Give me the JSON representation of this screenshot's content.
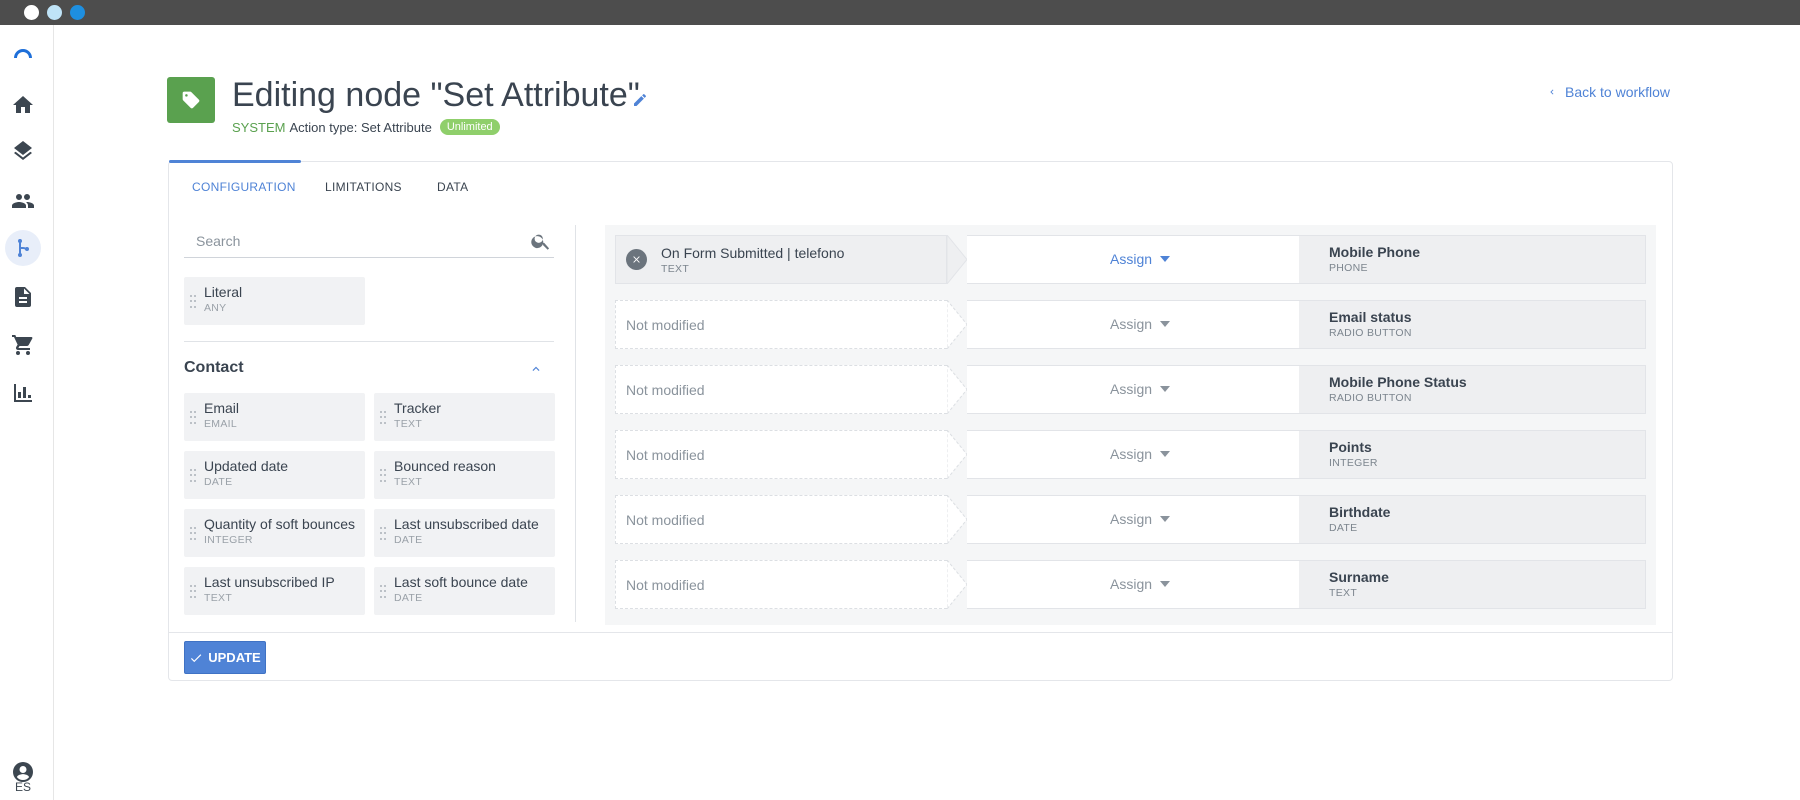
{
  "header": {
    "title": "Editing node \"Set Attribute\"",
    "system_label": "SYSTEM",
    "action_type": "Action type: Set Attribute",
    "badge": "Unlimited",
    "back_link": "Back to workflow"
  },
  "sidebar": {
    "items": [
      "logo-icon",
      "home-icon",
      "layers-icon",
      "people-icon",
      "workflow-icon",
      "document-icon",
      "cart-icon",
      "bar-chart-icon"
    ],
    "language": "ES"
  },
  "tabs": {
    "configuration": "CONFIGURATION",
    "limitations": "LIMITATIONS",
    "data": "DATA"
  },
  "search": {
    "placeholder": "Search"
  },
  "literal": {
    "name": "Literal",
    "type": "ANY"
  },
  "contact": {
    "title": "Contact",
    "fields": [
      {
        "name": "Email",
        "type": "EMAIL"
      },
      {
        "name": "Tracker",
        "type": "TEXT"
      },
      {
        "name": "Updated date",
        "type": "DATE"
      },
      {
        "name": "Bounced reason",
        "type": "TEXT"
      },
      {
        "name": "Quantity of soft bounces",
        "type": "INTEGER"
      },
      {
        "name": "Last unsubscribed date",
        "type": "DATE"
      },
      {
        "name": "Last unsubscribed IP",
        "type": "TEXT"
      },
      {
        "name": "Last soft bounce date",
        "type": "DATE"
      }
    ]
  },
  "mappings": [
    {
      "source": "On Form Submitted | telefono",
      "source_type": "TEXT",
      "action": "Assign",
      "target": "Mobile Phone",
      "target_type": "PHONE",
      "filled": true
    },
    {
      "source": "Not modified",
      "action": "Assign",
      "target": "Email status",
      "target_type": "RADIO BUTTON",
      "filled": false
    },
    {
      "source": "Not modified",
      "action": "Assign",
      "target": "Mobile Phone Status",
      "target_type": "RADIO BUTTON",
      "filled": false
    },
    {
      "source": "Not modified",
      "action": "Assign",
      "target": "Points",
      "target_type": "INTEGER",
      "filled": false
    },
    {
      "source": "Not modified",
      "action": "Assign",
      "target": "Birthdate",
      "target_type": "DATE",
      "filled": false
    },
    {
      "source": "Not modified",
      "action": "Assign",
      "target": "Surname",
      "target_type": "TEXT",
      "filled": false
    }
  ],
  "update_button": "UPDATE",
  "colors": {
    "accent": "#4f83d6",
    "success": "#5aa14f",
    "badge": "#8fcf6b"
  }
}
